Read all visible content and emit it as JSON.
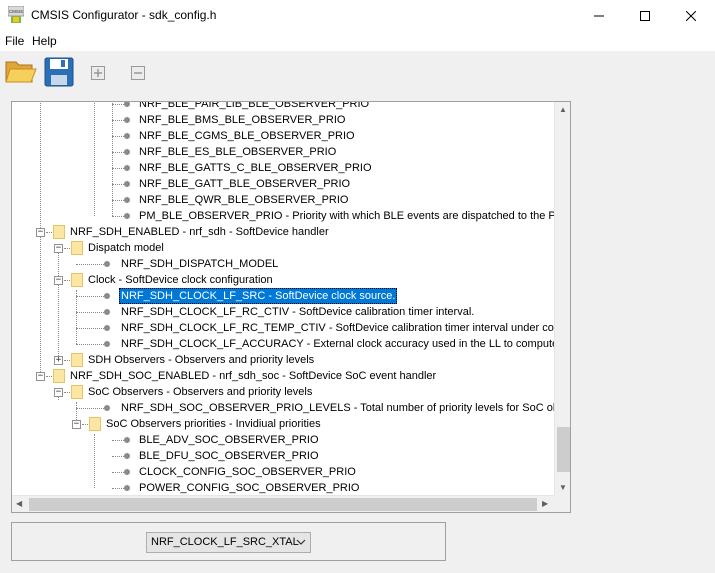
{
  "window": {
    "title": "CMSIS Configurator - sdk_config.h",
    "app_icon_text": "CMSIS"
  },
  "menu": {
    "file": "File",
    "help": "Help"
  },
  "tree": {
    "rows": [
      {
        "level": 4,
        "type": "leaf",
        "label": "NRF_BLE_PAIR_LIB_BLE_OBSERVER_PRIO"
      },
      {
        "level": 4,
        "type": "leaf",
        "label": "NRF_BLE_BMS_BLE_OBSERVER_PRIO"
      },
      {
        "level": 4,
        "type": "leaf",
        "label": "NRF_BLE_CGMS_BLE_OBSERVER_PRIO"
      },
      {
        "level": 4,
        "type": "leaf",
        "label": "NRF_BLE_ES_BLE_OBSERVER_PRIO"
      },
      {
        "level": 4,
        "type": "leaf",
        "label": "NRF_BLE_GATTS_C_BLE_OBSERVER_PRIO"
      },
      {
        "level": 4,
        "type": "leaf",
        "label": "NRF_BLE_GATT_BLE_OBSERVER_PRIO"
      },
      {
        "level": 4,
        "type": "leaf",
        "label": "NRF_BLE_QWR_BLE_OBSERVER_PRIO"
      },
      {
        "level": 4,
        "type": "leaf",
        "label": "PM_BLE_OBSERVER_PRIO - Priority with which BLE events are dispatched to the Peer Ma"
      },
      {
        "level": 1,
        "type": "folder",
        "expanded": true,
        "label": "NRF_SDH_ENABLED - nrf_sdh - SoftDevice handler"
      },
      {
        "level": 2,
        "type": "folder",
        "expanded": true,
        "label": "Dispatch model"
      },
      {
        "level": 3,
        "type": "leaf",
        "label": "NRF_SDH_DISPATCH_MODEL"
      },
      {
        "level": 2,
        "type": "folder",
        "expanded": true,
        "label": "Clock - SoftDevice clock configuration"
      },
      {
        "level": 3,
        "type": "leaf",
        "label": "NRF_SDH_CLOCK_LF_SRC  - SoftDevice clock source.",
        "selected": true
      },
      {
        "level": 3,
        "type": "leaf",
        "label": "NRF_SDH_CLOCK_LF_RC_CTIV - SoftDevice calibration timer interval."
      },
      {
        "level": 3,
        "type": "leaf",
        "label": "NRF_SDH_CLOCK_LF_RC_TEMP_CTIV - SoftDevice calibration timer interval under constant t"
      },
      {
        "level": 3,
        "type": "leaf",
        "label": "NRF_SDH_CLOCK_LF_ACCURACY  - External clock accuracy used in the LL to compute timing"
      },
      {
        "level": 2,
        "type": "folder",
        "expanded": false,
        "label": "SDH Observers - Observers and priority levels"
      },
      {
        "level": 1,
        "type": "folder",
        "expanded": true,
        "label": "NRF_SDH_SOC_ENABLED - nrf_sdh_soc - SoftDevice SoC event handler"
      },
      {
        "level": 2,
        "type": "folder",
        "expanded": true,
        "label": "SoC Observers - Observers and priority levels"
      },
      {
        "level": 3,
        "type": "leaf",
        "label": "NRF_SDH_SOC_OBSERVER_PRIO_LEVELS - Total number of priority levels for SoC observers"
      },
      {
        "level": 3,
        "type": "folder",
        "expanded": true,
        "label": "SoC Observers priorities - Invidiual priorities"
      },
      {
        "level": 4,
        "type": "leaf",
        "label": "BLE_ADV_SOC_OBSERVER_PRIO"
      },
      {
        "level": 4,
        "type": "leaf",
        "label": "BLE_DFU_SOC_OBSERVER_PRIO"
      },
      {
        "level": 4,
        "type": "leaf",
        "label": "CLOCK_CONFIG_SOC_OBSERVER_PRIO"
      },
      {
        "level": 4,
        "type": "leaf",
        "label": "POWER_CONFIG_SOC_OBSERVER_PRIO"
      }
    ]
  },
  "value_editor": {
    "selected_value": "NRF_CLOCK_LF_SRC_XTAL"
  },
  "colors": {
    "selection": "#0078d7",
    "folder": "#fbe6a3"
  }
}
